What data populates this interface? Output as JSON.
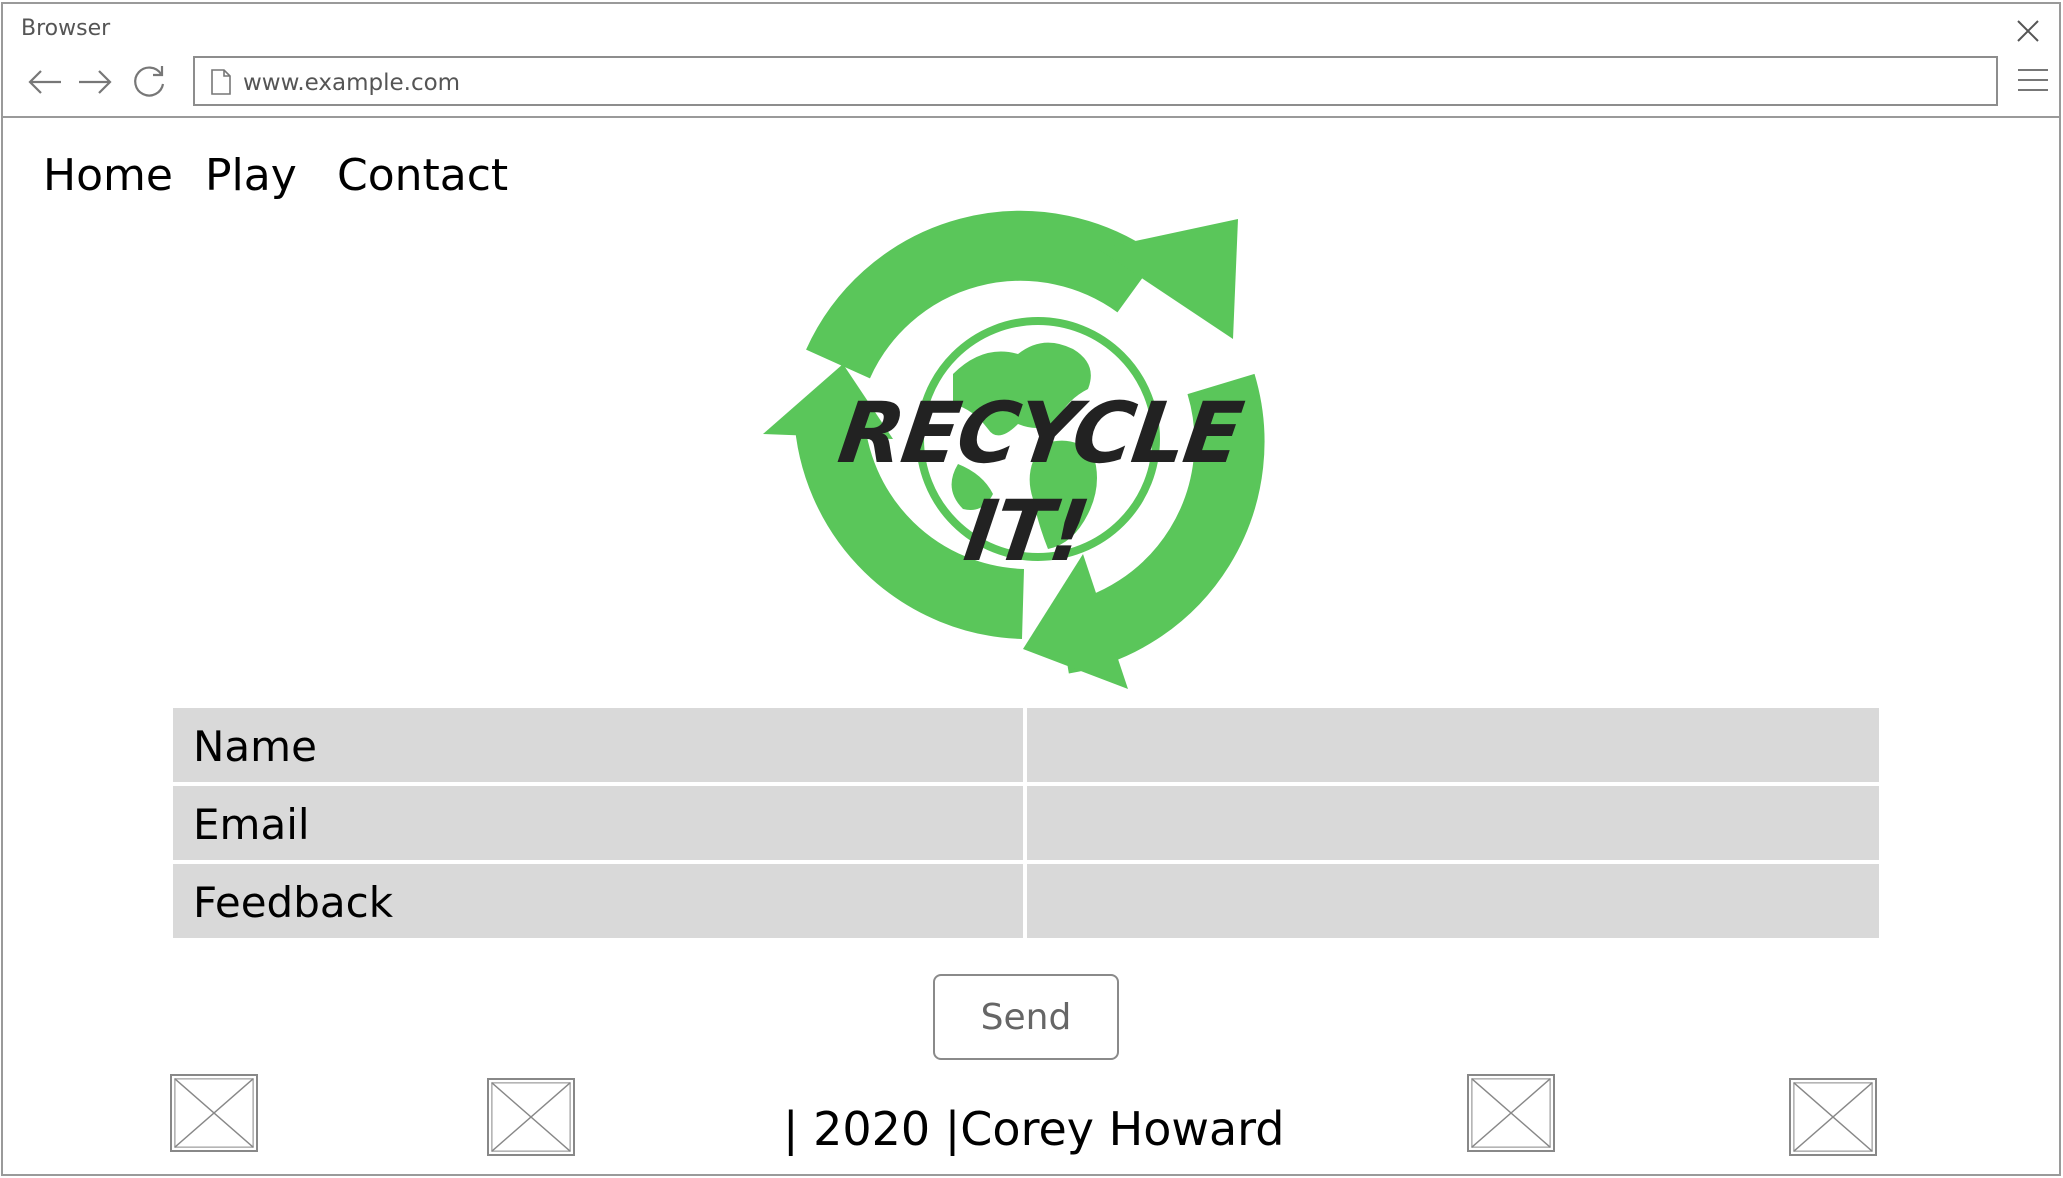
{
  "browser": {
    "title": "Browser",
    "url": "www.example.com",
    "icons": {
      "back": "arrow-left-icon",
      "forward": "arrow-right-icon",
      "reload": "reload-icon",
      "page": "page-icon",
      "menu": "hamburger-menu-icon",
      "close": "close-icon"
    }
  },
  "nav": {
    "items": [
      {
        "label": "Home"
      },
      {
        "label": "Play"
      },
      {
        "label": "Contact"
      }
    ]
  },
  "logo": {
    "text": "RECYCLE IT!",
    "colors": {
      "arrows": "#5ac65a",
      "text": "#222222"
    }
  },
  "form": {
    "rows": [
      {
        "label": "Name",
        "value": ""
      },
      {
        "label": "Email",
        "value": ""
      },
      {
        "label": "Feedback",
        "value": ""
      }
    ],
    "send_label": "Send"
  },
  "footer": {
    "text": "| 2020 |Corey Howard",
    "image_placeholders": 4
  },
  "colors": {
    "field_bg": "#d9d9d9",
    "border": "#9a9a9a",
    "logo_green": "#5ac65a"
  }
}
